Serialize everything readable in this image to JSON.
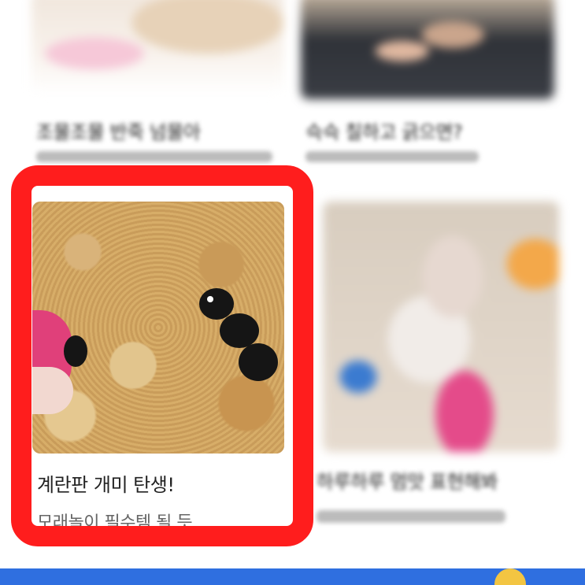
{
  "cards": [
    {
      "position": "top-left",
      "title": "조물조물 반죽 넘물아",
      "subtitle": "",
      "blurred": true
    },
    {
      "position": "top-right",
      "title": "슥슥 칠하고 긁으면?",
      "subtitle": "",
      "blurred": true
    },
    {
      "position": "bottom-left",
      "title": "계란판 개미 탄생!",
      "subtitle": "모래놀이 필수템 될 듯",
      "blurred": false,
      "highlighted": true
    },
    {
      "position": "bottom-right",
      "title": "하루하루 멈맛 표현해봐",
      "subtitle": "",
      "blurred": true
    }
  ],
  "highlight": {
    "color": "#ff1d1d"
  },
  "colors": {
    "bottom_bar": "#2f6fe0",
    "accent": "#f3c542"
  }
}
